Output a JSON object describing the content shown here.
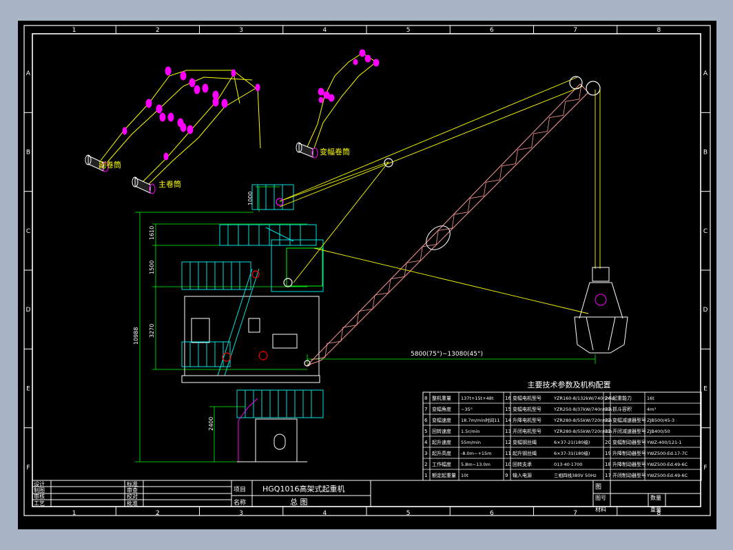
{
  "colors": {
    "background": "#000000",
    "frame": "#ffffff",
    "structure": "#00e5e5",
    "rope": "#ffff00",
    "boom": "#ff9999",
    "pulley": "#ff00ff",
    "text": "#ffffff",
    "label": "#ffff00",
    "dimension": "#00ff00",
    "window_bg": "#a9b4c4"
  },
  "grid": {
    "columns": [
      "1",
      "2",
      "3",
      "4",
      "5",
      "6",
      "7",
      "8"
    ],
    "rows": [
      "A",
      "B",
      "C",
      "D",
      "E",
      "F"
    ]
  },
  "drum_labels": {
    "aux_drum": "副卷筒",
    "main_drum": "主卷筒",
    "luffing_drum": "变幅卷筒"
  },
  "dimensions": {
    "h1": "1000",
    "h2": "1610",
    "h3": "1500",
    "h4": "3270",
    "h5": "2400",
    "total_height": "10988",
    "radius": "5800(75°)~13080(45°)"
  },
  "params": {
    "title": "主要技术参数及机构配置",
    "rows": [
      [
        {
          "n": "8",
          "k": "整机重量",
          "v": "137t+15t+48t"
        },
        {
          "n": "16",
          "k": "变幅电机型号",
          "v": "YZR160-8/132kW/740r/min"
        },
        {
          "n": "24",
          "k": "起重能力",
          "v": "16t"
        }
      ],
      [
        {
          "n": "7",
          "k": "变幅角度",
          "v": "~35°"
        },
        {
          "n": "15",
          "k": "变幅电机型号",
          "v": "YZR250-8/37kW/740r/min"
        },
        {
          "n": "23",
          "k": "抓斗容积",
          "v": "4m³"
        }
      ],
      [
        {
          "n": "6",
          "k": "变幅速度",
          "v": "18.7m/min时间11"
        },
        {
          "n": "14",
          "k": "升降电机型号",
          "v": "YZR280-8/55kW/720r/min"
        },
        {
          "n": "22",
          "k": "变幅减速器型号",
          "v": "ZJB500/45-3"
        }
      ],
      [
        {
          "n": "5",
          "k": "回转速度",
          "v": "1.5r/min"
        },
        {
          "n": "13",
          "k": "开闭电机型号",
          "v": "YZR280-8/55kW/720r/min"
        },
        {
          "n": "21",
          "k": "开闭减速器型号",
          "v": "ZJB400/50"
        }
      ],
      [
        {
          "n": "4",
          "k": "起升速度",
          "v": "55m/min"
        },
        {
          "n": "12",
          "k": "变幅钢丝绳",
          "v": "6×37-21(180级)"
        },
        {
          "n": "20",
          "k": "变幅制动器型号",
          "v": "YWZ-400/121-1"
        }
      ],
      [
        {
          "n": "3",
          "k": "起升高度",
          "v": "-8.0m~+15m"
        },
        {
          "n": "11",
          "k": "起升钢丝绳",
          "v": "6×37-31(180级)"
        },
        {
          "n": "19",
          "k": "升降制动器型号",
          "v": "YWZ500-Ed.17-7C"
        }
      ],
      [
        {
          "n": "2",
          "k": "工作幅度",
          "v": "5.8m~13.0m"
        },
        {
          "n": "10",
          "k": "回转支承",
          "v": "013·40·1700"
        },
        {
          "n": "18",
          "k": "升降制动器型号",
          "v": "YWZ500-Ed.49-6C"
        }
      ],
      [
        {
          "n": "1",
          "k": "额定起重量",
          "v": "10t"
        },
        {
          "n": "9",
          "k": "输入电源",
          "v": "三相四线380V 50Hz"
        },
        {
          "n": "17",
          "k": "开闭制动器型号",
          "v": "YWZ500-Ed.49-6C"
        }
      ]
    ]
  },
  "title_block": {
    "left_labels": [
      "设计",
      "制图",
      "审核",
      "工艺"
    ],
    "mid_labels": [
      "标准",
      "审查",
      "校对",
      "批准"
    ],
    "project_label": "项目",
    "project_value": "HGQ1016高架式起重机",
    "name_label": "名称",
    "name_value": "总  图",
    "drawing_label": "图",
    "drawing_no_label": "图号",
    "quantity_label": "数量",
    "material_label": "材料",
    "weight_label": "重量"
  }
}
